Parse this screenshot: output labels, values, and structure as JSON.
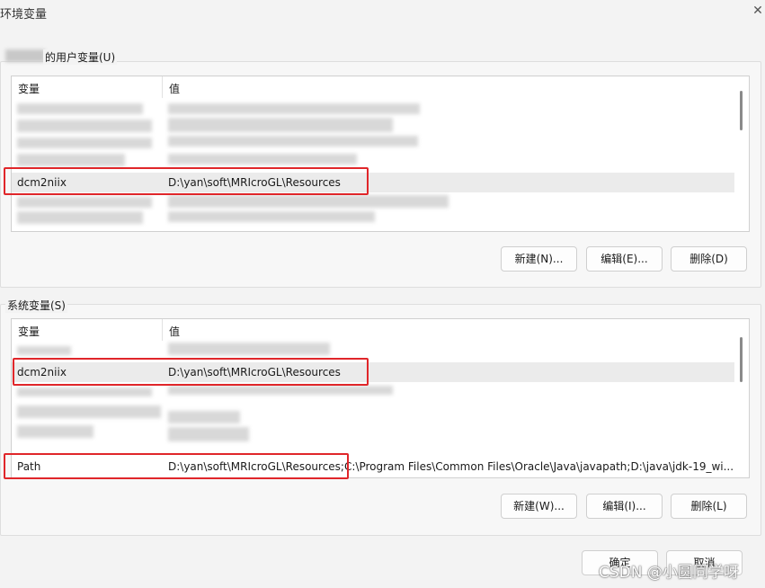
{
  "window": {
    "title": "环境变量",
    "close_glyph": "✕"
  },
  "user_vars": {
    "label": "的用户变量(U)",
    "col_name": "变量",
    "col_value": "值",
    "visible_row": {
      "name": "dcm2niix",
      "value": "D:\\yan\\soft\\MRIcroGL\\Resources"
    },
    "buttons": {
      "new": "新建(N)...",
      "edit": "编辑(E)...",
      "delete": "删除(D)"
    }
  },
  "system_vars": {
    "label": "系统变量(S)",
    "col_name": "变量",
    "col_value": "值",
    "rows": [
      {
        "name": "dcm2niix",
        "value": "D:\\yan\\soft\\MRIcroGL\\Resources"
      },
      {
        "name": "Path",
        "value": "D:\\yan\\soft\\MRIcroGL\\Resources;C:\\Program Files\\Common Files\\Oracle\\Java\\javapath;D:\\java\\jdk-19_wi..."
      }
    ],
    "buttons": {
      "new": "新建(W)...",
      "edit": "编辑(I)...",
      "delete": "删除(L)"
    }
  },
  "footer": {
    "ok": "确定",
    "cancel": "取消"
  },
  "watermark": "CSDN @小圆同学呀",
  "colors": {
    "highlight": "#e0262a",
    "selected_row": "#ebebeb"
  }
}
